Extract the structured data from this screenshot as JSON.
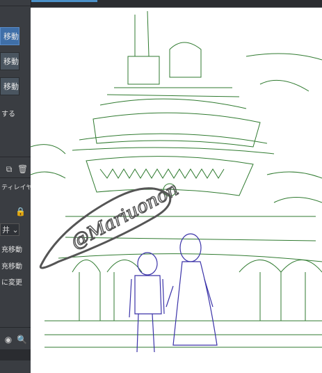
{
  "sidebar": {
    "buttons": [
      {
        "label": "移動",
        "active": true
      },
      {
        "label": "移動",
        "active": false
      },
      {
        "label": "移動",
        "active": false
      }
    ],
    "text_suru": "する",
    "layer_label": "ティレイヤ",
    "dropdown_value": "井",
    "tool_items": [
      "充移動",
      "充移動",
      "に変更"
    ]
  },
  "canvas": {
    "signature_text": "@Mariuonon",
    "sketch_colors": {
      "background": "#2f7a2f",
      "characters": "#3a32a8",
      "signature": "#555555"
    }
  },
  "colors": {
    "accent": "#3f6fa8",
    "panel": "#3a3d42"
  }
}
